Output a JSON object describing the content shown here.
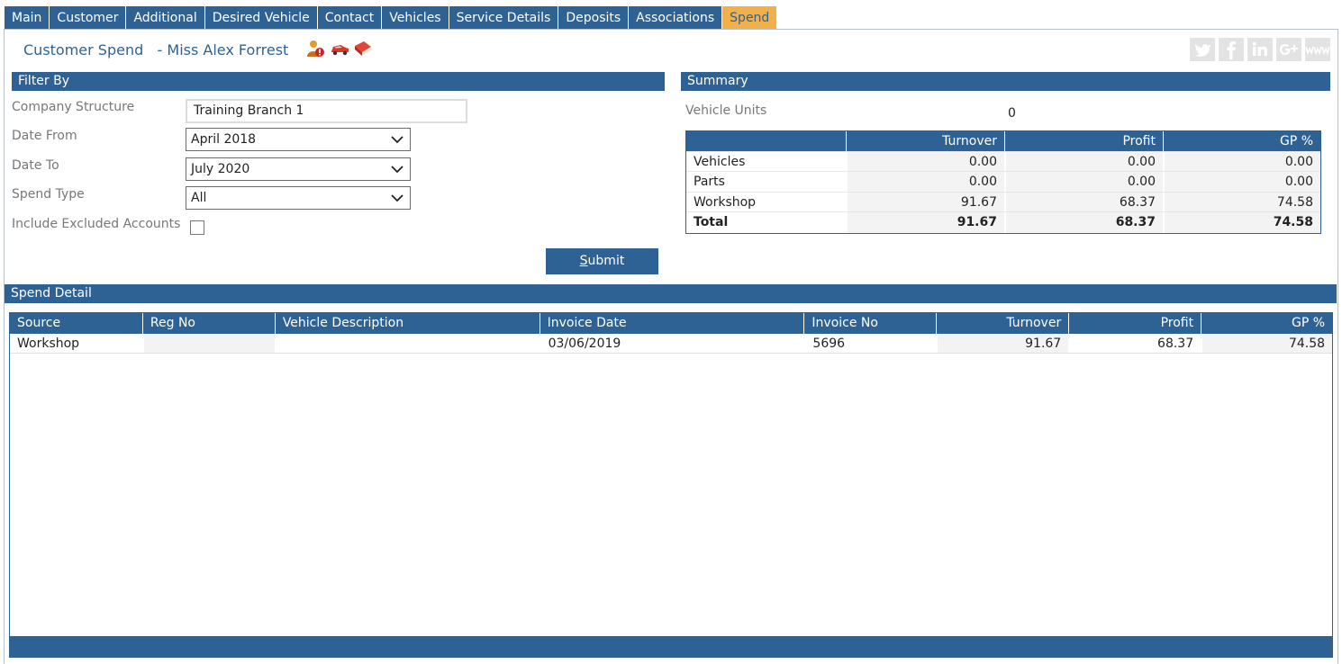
{
  "tabs": [
    "Main",
    "Customer",
    "Additional",
    "Desired Vehicle",
    "Contact",
    "Vehicles",
    "Service Details",
    "Deposits",
    "Associations",
    "Spend"
  ],
  "active_tab": "Spend",
  "page_title": "Customer Spend",
  "customer_name": "- Miss Alex Forrest",
  "title_icons": [
    "user-alert-icon",
    "car-icon",
    "book-icon"
  ],
  "social": [
    "twitter-icon",
    "facebook-icon",
    "linkedin-icon",
    "google-plus-icon",
    "www-icon"
  ],
  "filter": {
    "header": "Filter By",
    "company_structure_label": "Company Structure",
    "company_structure_value": "Training Branch 1",
    "date_from_label": "Date From",
    "date_from_value": "April 2018",
    "date_to_label": "Date To",
    "date_to_value": "July 2020",
    "spend_type_label": "Spend Type",
    "spend_type_value": "All",
    "include_excluded_label": "Include Excluded Accounts",
    "include_excluded_checked": false,
    "submit_label_first": "S",
    "submit_label_rest": "ubmit"
  },
  "summary": {
    "header": "Summary",
    "vehicle_units_label": "Vehicle Units",
    "vehicle_units_value": "0",
    "columns": [
      "",
      "Turnover",
      "Profit",
      "GP %"
    ],
    "rows": [
      [
        "Vehicles",
        "0.00",
        "0.00",
        "0.00"
      ],
      [
        "Parts",
        "0.00",
        "0.00",
        "0.00"
      ],
      [
        "Workshop",
        "91.67",
        "68.37",
        "74.58"
      ]
    ],
    "total": [
      "Total",
      "91.67",
      "68.37",
      "74.58"
    ]
  },
  "detail": {
    "header": "Spend Detail",
    "columns": [
      "Source",
      "Reg No",
      "Vehicle Description",
      "Invoice Date",
      "Invoice No",
      "Turnover",
      "Profit",
      "GP %"
    ],
    "rows": [
      [
        "Workshop",
        "",
        "",
        "03/06/2019",
        "5696",
        "91.67",
        "68.37",
        "74.58"
      ]
    ]
  }
}
